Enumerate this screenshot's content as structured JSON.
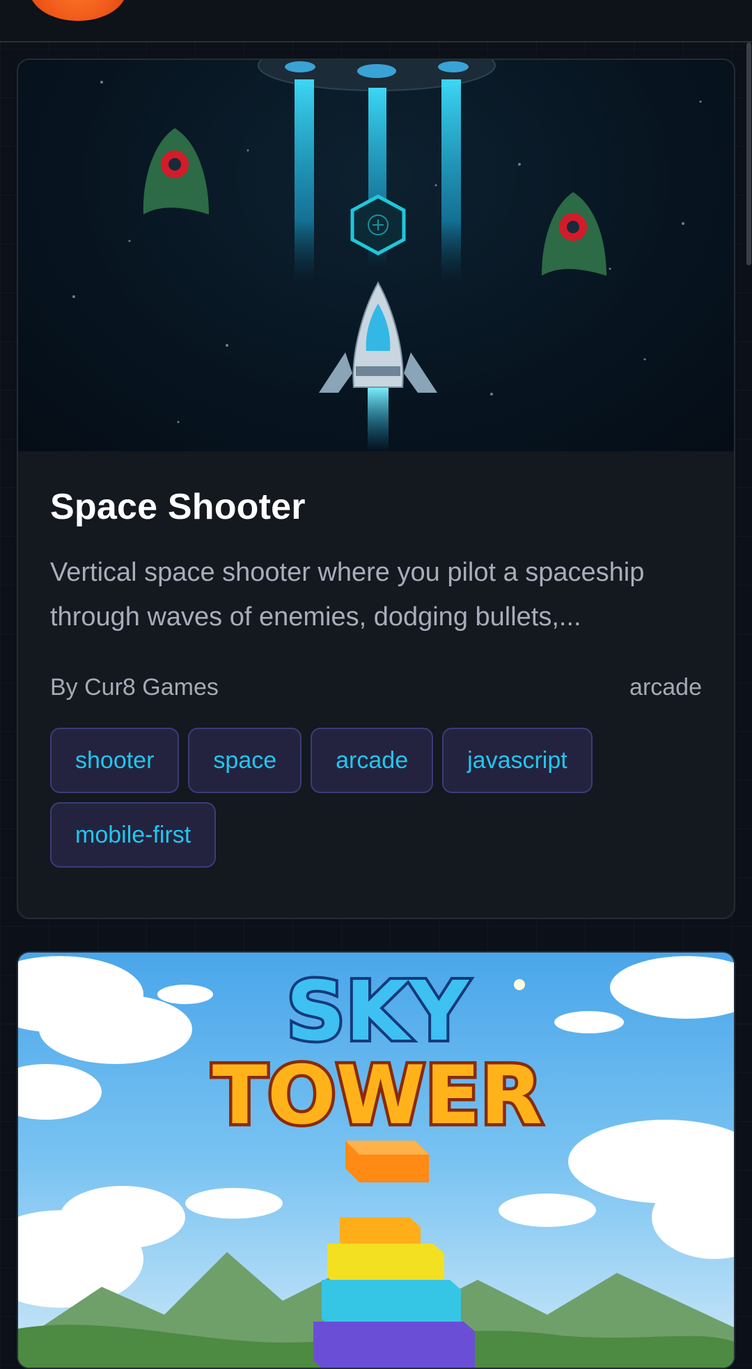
{
  "games": [
    {
      "title": "Space Shooter",
      "description": "Vertical space shooter where you pilot a spaceship through waves of enemies, dodging bullets,...",
      "author": "By Cur8 Games",
      "category": "arcade",
      "tags": [
        "shooter",
        "space",
        "arcade",
        "javascript",
        "mobile-first"
      ],
      "thumbnail_icon": "spaceship-icon"
    },
    {
      "thumbnail_title_line1": "SKY",
      "thumbnail_title_line2": "TOWER",
      "thumbnail_icon": "block-tower-icon"
    }
  ],
  "colors": {
    "background": "#0c1018",
    "card": "#161921",
    "tag_text": "#22c6ee",
    "tag_bg": "#24233f",
    "logo": "#f15a1a"
  }
}
